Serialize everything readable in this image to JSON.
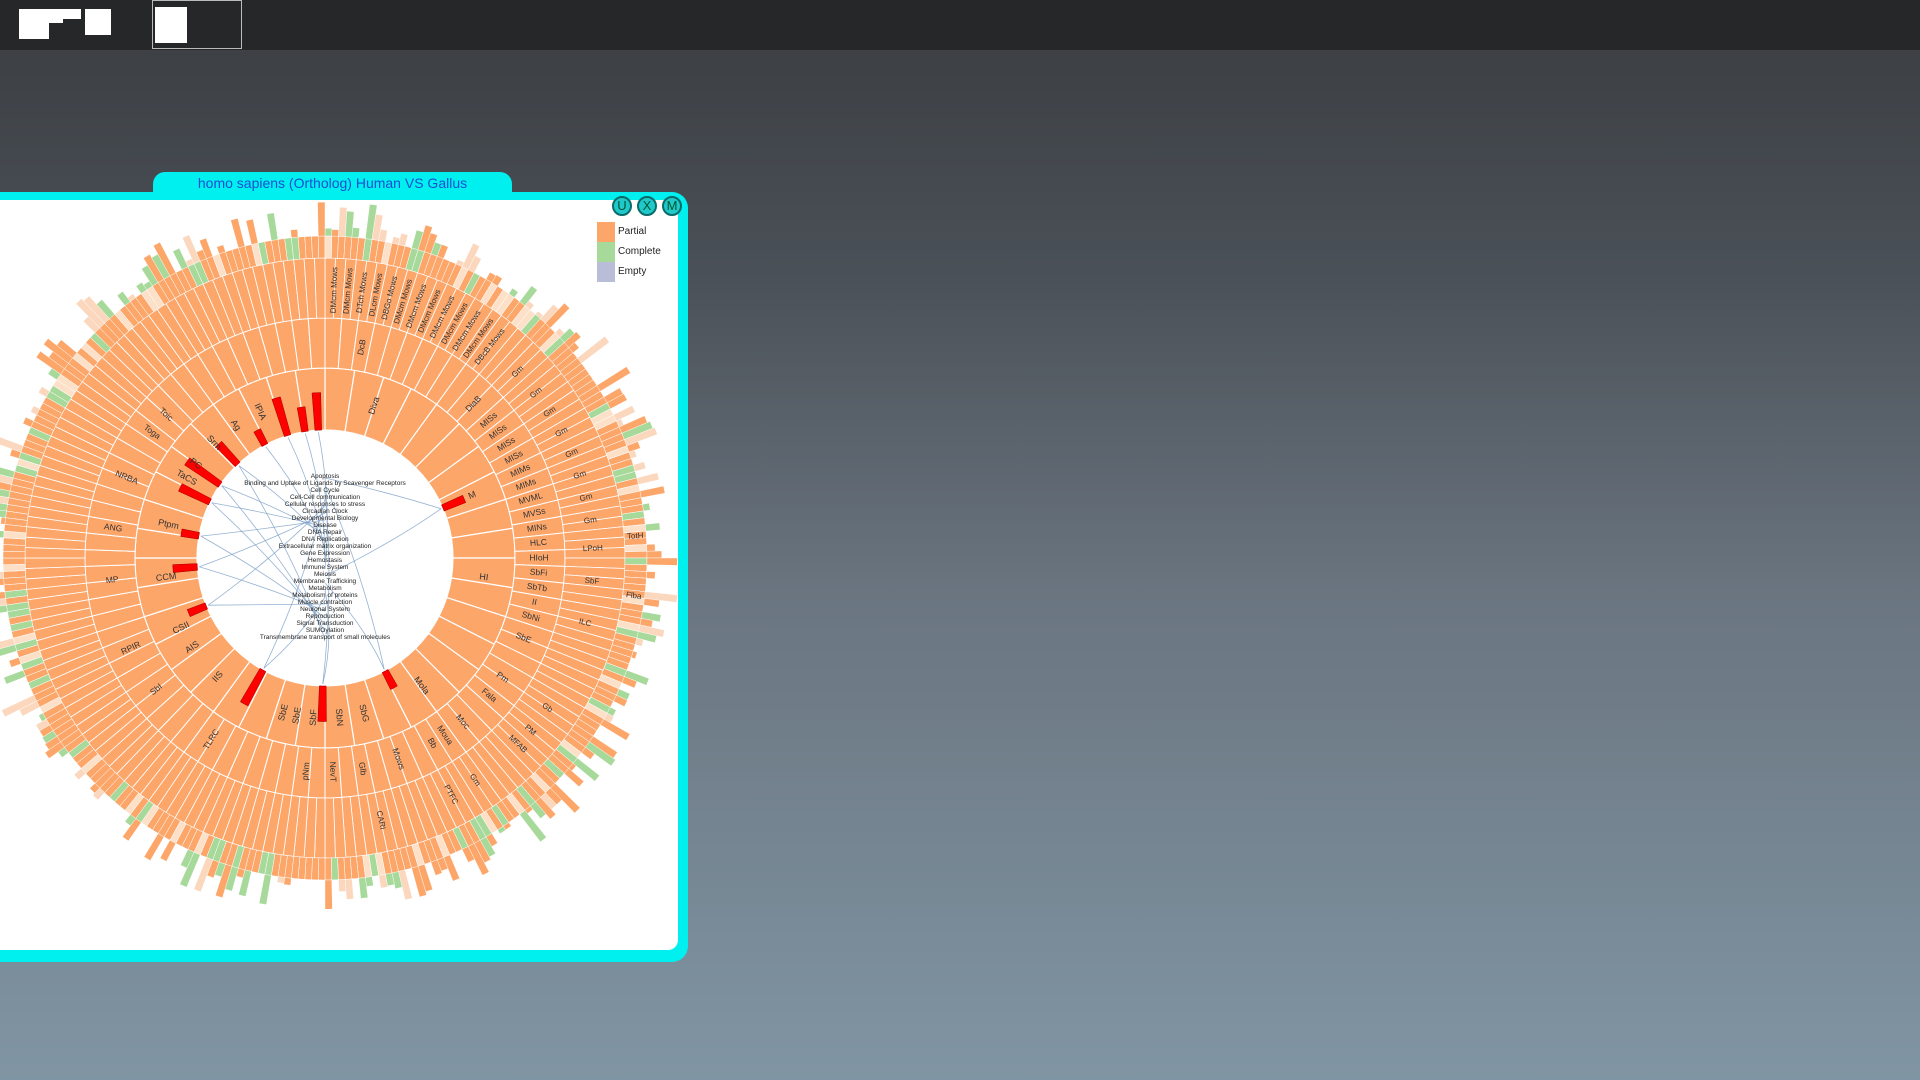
{
  "taskbar": {
    "app_icon": "window-layout-icon",
    "active_slot": "open-window-thumbnail"
  },
  "window": {
    "title": "homo sapiens (Ortholog) Human VS Gallus",
    "buttons": [
      {
        "label": "U",
        "name": "u-button"
      },
      {
        "label": "X",
        "name": "close-button"
      },
      {
        "label": "M",
        "name": "maximize-button"
      }
    ]
  },
  "legend": [
    {
      "label": "Partial",
      "color": "#fca66a"
    },
    {
      "label": "Complete",
      "color": "#a6d99a"
    },
    {
      "label": "Empty",
      "color": "#b9bdd8"
    }
  ],
  "colors": {
    "accent": "#00f0f0",
    "partial": "#fca66a",
    "complete": "#a6d99a",
    "highlight": "#ff0000",
    "link": "#7b9fc7"
  },
  "chart_data": {
    "type": "sunburst",
    "center_categories": [
      "Apoptosis",
      "Binding and Uptake of Ligands by Scavenger Receptors",
      "Cell Cycle",
      "Cell-Cell communication",
      "Cellular responses to stress",
      "Circadian Clock",
      "Developmental Biology",
      "Disease",
      "DNA Repair",
      "DNA Replication",
      "Extracellular matrix organization",
      "Gene Expression",
      "Hemostasis",
      "Immune System",
      "Meiosis",
      "Membrane Trafficking",
      "Metabolism",
      "Metabolism of proteins",
      "Muscle contraction",
      "Neuronal System",
      "Reproduction",
      "Signal Transduction",
      "SUMOylation",
      "Transmembrane transport of small molecules"
    ],
    "ring1_labels": [
      {
        "label": "Diva",
        "angle": 18
      },
      {
        "label": "M",
        "angle": 67
      },
      {
        "label": "HI",
        "angle": 97
      },
      {
        "label": "Mola",
        "angle": 143
      },
      {
        "label": "SbG",
        "angle": 166
      },
      {
        "label": "SbN",
        "angle": 175
      },
      {
        "label": "SbF",
        "angle": 184
      },
      {
        "label": "SbE",
        "angle": 190
      },
      {
        "label": "SbE",
        "angle": 195
      },
      {
        "label": "IIS",
        "angle": 222
      },
      {
        "label": "AIS",
        "angle": 236
      },
      {
        "label": "CSII",
        "angle": 244
      },
      {
        "label": "CCM",
        "angle": 263
      },
      {
        "label": "Ptpm",
        "angle": 282
      },
      {
        "label": "TaCS",
        "angle": 300
      },
      {
        "label": "PC",
        "angle": 306
      },
      {
        "label": "Srm",
        "angle": 316
      },
      {
        "label": "Ag",
        "angle": 326
      },
      {
        "label": "IPIA",
        "angle": 336
      }
    ],
    "ring2_labels": [
      {
        "label": "DcB",
        "angle": 10
      },
      {
        "label": "DiaB",
        "angle": 44
      },
      {
        "label": "MISs",
        "angle": 50
      },
      {
        "label": "MISs",
        "angle": 54
      },
      {
        "label": "MISs",
        "angle": 58
      },
      {
        "label": "MISs",
        "angle": 62
      },
      {
        "label": "MIMs",
        "angle": 66
      },
      {
        "label": "MIMs",
        "angle": 70
      },
      {
        "label": "MVML",
        "angle": 74
      },
      {
        "label": "MVSs",
        "angle": 78
      },
      {
        "label": "MINs",
        "angle": 82
      },
      {
        "label": "HLC",
        "angle": 86
      },
      {
        "label": "HIoH",
        "angle": 90
      },
      {
        "label": "SbFi",
        "angle": 94
      },
      {
        "label": "SbTb",
        "angle": 98
      },
      {
        "label": "II",
        "angle": 102
      },
      {
        "label": "SbNi",
        "angle": 106
      },
      {
        "label": "SbE",
        "angle": 112
      },
      {
        "label": "Pm",
        "angle": 124
      },
      {
        "label": "Fala",
        "angle": 130
      },
      {
        "label": "Moc",
        "angle": 140
      },
      {
        "label": "Moua",
        "angle": 146
      },
      {
        "label": "Bb",
        "angle": 150
      },
      {
        "label": "Mows",
        "angle": 160
      },
      {
        "label": "Glb",
        "angle": 170
      },
      {
        "label": "NevT",
        "angle": 178
      },
      {
        "label": "pNm",
        "angle": 185
      },
      {
        "label": "TLRC",
        "angle": 212
      },
      {
        "label": "SbI",
        "angle": 232
      },
      {
        "label": "RPIR",
        "angle": 245
      },
      {
        "label": "MP",
        "angle": 264
      },
      {
        "label": "ANG",
        "angle": 278
      },
      {
        "label": "NRBA",
        "angle": 292
      },
      {
        "label": "Toga",
        "angle": 306
      },
      {
        "label": "Toic",
        "angle": 312
      }
    ],
    "ring3_labels": [
      {
        "label": "DMcm Mows",
        "angle": 2
      },
      {
        "label": "DMcm Mows",
        "angle": 5
      },
      {
        "label": "DTch Mows",
        "angle": 8
      },
      {
        "label": "DLcm Mows",
        "angle": 11
      },
      {
        "label": "DBGo Mows",
        "angle": 14
      },
      {
        "label": "DMcm Mows",
        "angle": 17
      },
      {
        "label": "DMcm Mows",
        "angle": 20
      },
      {
        "label": "DMcm Mows",
        "angle": 23
      },
      {
        "label": "DMcm Mows",
        "angle": 26
      },
      {
        "label": "DMcm Mows",
        "angle": 29
      },
      {
        "label": "DMcm Mows",
        "angle": 32
      },
      {
        "label": "DMcm Mows",
        "angle": 35
      },
      {
        "label": "DBcB Mows",
        "angle": 38
      },
      {
        "label": "Gm",
        "angle": 46
      },
      {
        "label": "Gm",
        "angle": 52
      },
      {
        "label": "Gm",
        "angle": 57
      },
      {
        "label": "Gm",
        "angle": 62
      },
      {
        "label": "Gm",
        "angle": 67
      },
      {
        "label": "Gm",
        "angle": 72
      },
      {
        "label": "Gm",
        "angle": 77
      },
      {
        "label": "Gm",
        "angle": 82
      },
      {
        "label": "LPoH",
        "angle": 88
      },
      {
        "label": "SbF",
        "angle": 95
      },
      {
        "label": "ILC",
        "angle": 104
      },
      {
        "label": "Gb",
        "angle": 124
      },
      {
        "label": "PM",
        "angle": 130
      },
      {
        "label": "MFAB",
        "angle": 134
      },
      {
        "label": "Gm",
        "angle": 146
      },
      {
        "label": "PTFC",
        "angle": 152
      },
      {
        "label": "CARI",
        "angle": 168
      }
    ],
    "ring4_labels": [
      {
        "label": "TotH",
        "angle": 86
      },
      {
        "label": "Flba",
        "angle": 97
      }
    ],
    "highlight_angles": [
      67,
      152,
      181,
      209,
      248,
      266,
      280,
      296,
      305,
      317,
      332,
      343,
      351,
      357
    ]
  }
}
